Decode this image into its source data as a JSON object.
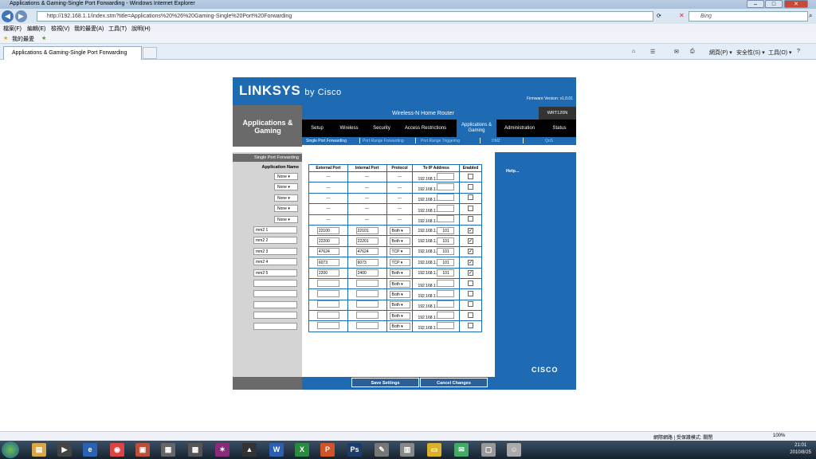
{
  "window": {
    "title": "Applications & Gaming-Single Port Forwarding - Windows Internet Explorer"
  },
  "address": {
    "url": "http://192.168.1.1/index.stm?title=Applications%20%26%20Gaming-Single%20Port%20Forwarding",
    "search_placeholder": "Bing"
  },
  "menu": [
    "檔案(F)",
    "編輯(E)",
    "檢視(V)",
    "我的最愛(A)",
    "工具(T)",
    "說明(H)"
  ],
  "favorites": {
    "label": "我的最愛"
  },
  "tab": {
    "label": "Applications & Gaming-Single Port Forwarding"
  },
  "toolbar": {
    "page": "網頁(P) ▾",
    "safety": "安全性(S) ▾",
    "tools": "工具(O) ▾",
    "help": "?"
  },
  "router": {
    "brand": "LINKSYS",
    "brand_suffix": "by Cisco",
    "firmware": "Firmware Version: v1.0.01",
    "section": "Applications & Gaming",
    "product": "Wireless-N Home Router",
    "model": "WRT120N",
    "main_tabs": [
      "Setup",
      "Wireless",
      "Security",
      "Access Restrictions",
      "Applications & Gaming",
      "Administration",
      "Status"
    ],
    "sub_tabs": [
      "Single Port Forwarding",
      "Port Range Forwarding",
      "Port Range Triggering",
      "DMZ",
      "QoS"
    ],
    "left_label": "Single Port Forwarding",
    "app_name_label": "Application Name",
    "help": "Help...",
    "cisco": "CISCO",
    "save": "Save Settings",
    "cancel": "Cancel Changes"
  },
  "table": {
    "headers": [
      "External Port",
      "Internal Port",
      "Protocol",
      "To IP Address",
      "Enabled"
    ],
    "ip_prefix": "192.168.1.",
    "rows": [
      {
        "app": "None",
        "ext": "---",
        "int": "---",
        "proto": "---",
        "ip": "",
        "enabled": false,
        "type": "preset"
      },
      {
        "app": "None",
        "ext": "---",
        "int": "---",
        "proto": "---",
        "ip": "",
        "enabled": false,
        "type": "preset"
      },
      {
        "app": "None",
        "ext": "---",
        "int": "---",
        "proto": "---",
        "ip": "",
        "enabled": false,
        "type": "preset"
      },
      {
        "app": "None",
        "ext": "---",
        "int": "---",
        "proto": "---",
        "ip": "",
        "enabled": false,
        "type": "preset"
      },
      {
        "app": "None",
        "ext": "---",
        "int": "---",
        "proto": "---",
        "ip": "",
        "enabled": false,
        "type": "preset"
      },
      {
        "app": "mm2 1",
        "ext": "22100",
        "int": "22101",
        "proto": "Both",
        "ip": "101",
        "enabled": true,
        "type": "custom"
      },
      {
        "app": "mm2 2",
        "ext": "22200",
        "int": "22201",
        "proto": "Both",
        "ip": "101",
        "enabled": true,
        "type": "custom"
      },
      {
        "app": "mm2 3",
        "ext": "47624",
        "int": "47624",
        "proto": "TCP",
        "ip": "101",
        "enabled": true,
        "type": "custom"
      },
      {
        "app": "mm2 4",
        "ext": "6073",
        "int": "6073",
        "proto": "TCP",
        "ip": "101",
        "enabled": true,
        "type": "custom"
      },
      {
        "app": "mm2 5",
        "ext": "2200",
        "int": "2400",
        "proto": "Both",
        "ip": "101",
        "enabled": true,
        "type": "custom"
      },
      {
        "app": "",
        "ext": "",
        "int": "",
        "proto": "Both",
        "ip": "",
        "enabled": false,
        "type": "custom"
      },
      {
        "app": "",
        "ext": "",
        "int": "",
        "proto": "Both",
        "ip": "",
        "enabled": false,
        "type": "custom"
      },
      {
        "app": "",
        "ext": "",
        "int": "",
        "proto": "Both",
        "ip": "",
        "enabled": false,
        "type": "custom"
      },
      {
        "app": "",
        "ext": "",
        "int": "",
        "proto": "Both",
        "ip": "",
        "enabled": false,
        "type": "custom"
      },
      {
        "app": "",
        "ext": "",
        "int": "",
        "proto": "Both",
        "ip": "",
        "enabled": false,
        "type": "custom"
      }
    ]
  },
  "status": {
    "zone": "網際網路 | 受保護模式: 關閉",
    "zoom": "100%"
  },
  "clock": {
    "time": "21:01",
    "date": "2010/8/25"
  },
  "colors": {
    "linksys_blue": "#1e6ab3",
    "dark_gray": "#6a6a6a"
  }
}
